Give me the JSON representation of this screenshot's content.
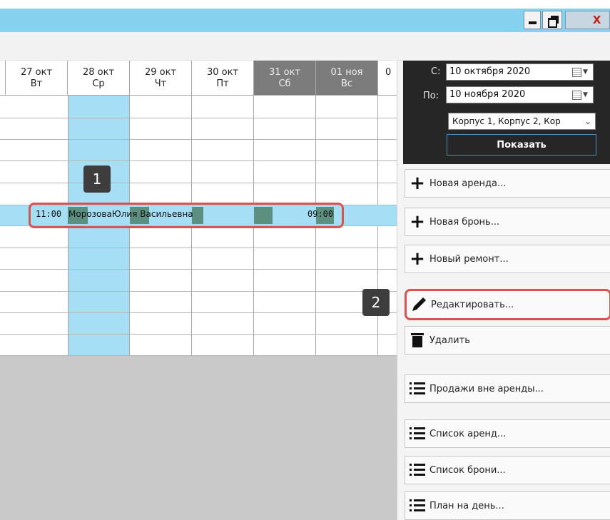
{
  "window": {
    "minimize_glyph": "–",
    "close_glyph": "X"
  },
  "calendar": {
    "days": [
      {
        "date": "27 окт",
        "weekday": "Вт",
        "weekend": false
      },
      {
        "date": "28 окт",
        "weekday": "Ср",
        "weekend": false
      },
      {
        "date": "29 окт",
        "weekday": "Чт",
        "weekend": false
      },
      {
        "date": "30 окт",
        "weekday": "Пт",
        "weekend": false
      },
      {
        "date": "31 окт",
        "weekday": "Сб",
        "weekend": true
      },
      {
        "date": "01 ноя",
        "weekday": "Вс",
        "weekend": true
      },
      {
        "date": "0",
        "weekday": "",
        "weekend": false
      }
    ],
    "reservation": {
      "start_time": "11:00",
      "guest_name": "МорозоваЮлия Васильевна",
      "end_time": "09:00"
    },
    "badge1": "1"
  },
  "filter": {
    "from_label": "С:",
    "from_value": "10 октября  2020",
    "to_label": "По:",
    "to_value": "10  ноября  2020",
    "buildings_value": "Корпус 1, Корпус 2, Кор",
    "show_button": "Показать"
  },
  "actions": {
    "new_rent": "Новая аренда...",
    "new_booking": "Новая бронь...",
    "new_repair": "Новый ремонт...",
    "edit": "Редактировать...",
    "delete": "Удалить",
    "sales_outside_rent": "Продажи вне аренды...",
    "rent_list": "Список аренд...",
    "booking_list": "Список брони...",
    "day_plan": "План на день..."
  },
  "badge2": "2",
  "colors": {
    "titlebar": "#85d1ee",
    "today_column": "#a6def6",
    "weekend_header": "#7c7c7c",
    "highlight": "#d9534f",
    "filter_panel": "#262626"
  }
}
